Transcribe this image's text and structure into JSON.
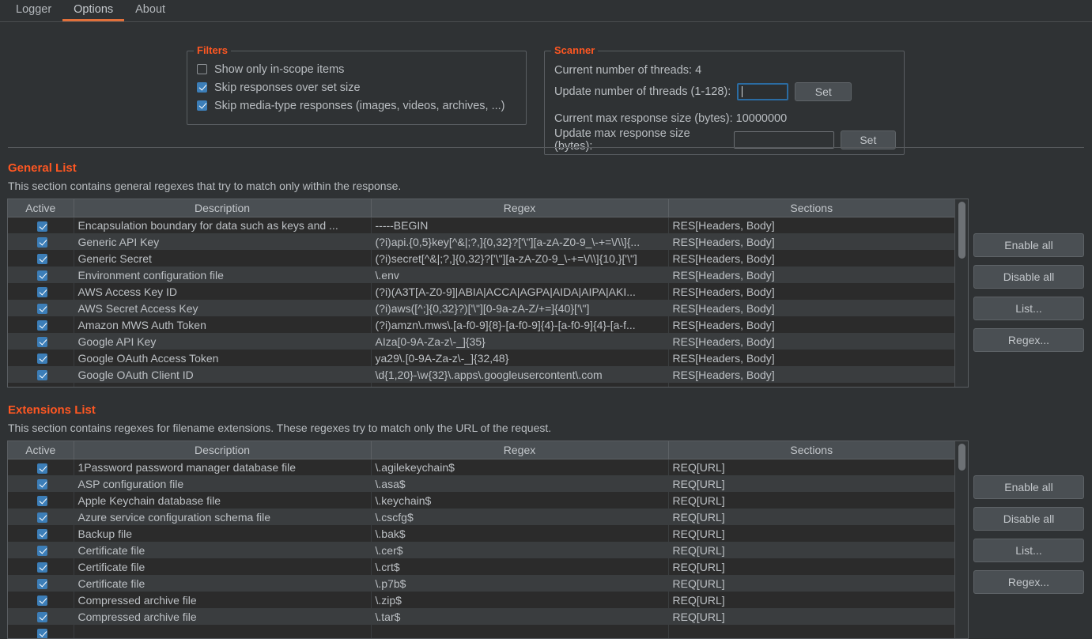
{
  "tabs": [
    {
      "label": "Logger",
      "active": false
    },
    {
      "label": "Options",
      "active": true
    },
    {
      "label": "About",
      "active": false
    }
  ],
  "colors": {
    "accent": "#ff5722",
    "tab_active_underline": "#e2703a",
    "checkbox_checked": "#3c7eb8",
    "focus_border": "#2b6ca3",
    "background": "#2f3234",
    "row_odd": "#2b2b2b",
    "row_even": "#3a3d3f",
    "header_bg": "#4a4f53"
  },
  "filters": {
    "legend": "Filters",
    "options": [
      {
        "label": "Show only in-scope items",
        "checked": false
      },
      {
        "label": "Skip responses over set size",
        "checked": true
      },
      {
        "label": "Skip media-type responses (images, videos, archives, ...)",
        "checked": true
      }
    ]
  },
  "scanner": {
    "legend": "Scanner",
    "current_threads_label": "Current number of threads: 4",
    "update_threads_label": "Update number of threads (1-128):",
    "threads_input_value": "",
    "threads_set_label": "Set",
    "current_maxsize_label": "Current max response size (bytes): 10000000",
    "update_maxsize_label": "Update max response size (bytes):",
    "maxsize_input_value": "",
    "maxsize_set_label": "Set"
  },
  "general_list": {
    "title": "General List",
    "description": "This section contains general regexes that try to match only within the response.",
    "columns": [
      "Active",
      "Description",
      "Regex",
      "Sections"
    ],
    "buttons": [
      "Enable all",
      "Disable all",
      "List...",
      "Regex..."
    ],
    "rows": [
      {
        "active": true,
        "description": "Encapsulation boundary for data such as keys and ...",
        "regex": "-----BEGIN",
        "sections": "RES[Headers, Body]"
      },
      {
        "active": true,
        "description": "Generic API Key",
        "regex": "(?i)api.{0,5}key[^&|;?,]{0,32}?['\\\"][a-zA-Z0-9_\\-+=\\/\\\\]{...",
        "sections": "RES[Headers, Body]"
      },
      {
        "active": true,
        "description": "Generic Secret",
        "regex": "(?i)secret[^&|;?,]{0,32}?['\\\"][a-zA-Z0-9_\\-+=\\/\\\\]{10,}['\\\"]",
        "sections": "RES[Headers, Body]"
      },
      {
        "active": true,
        "description": "Environment configuration file",
        "regex": "\\.env",
        "sections": "RES[Headers, Body]"
      },
      {
        "active": true,
        "description": "AWS Access Key ID",
        "regex": "(?i)(A3T[A-Z0-9]|ABIA|ACCA|AGPA|AIDA|AIPA|AKI...",
        "sections": "RES[Headers, Body]"
      },
      {
        "active": true,
        "description": "AWS Secret Access Key",
        "regex": "(?i)aws([^;]{0,32}?)['\\\"][0-9a-zA-Z/+=]{40}['\\\"]",
        "sections": "RES[Headers, Body]"
      },
      {
        "active": true,
        "description": "Amazon MWS Auth Token",
        "regex": "(?i)amzn\\.mws\\.[a-f0-9]{8}-[a-f0-9]{4}-[a-f0-9]{4}-[a-f...",
        "sections": "RES[Headers, Body]"
      },
      {
        "active": true,
        "description": "Google API Key",
        "regex": "AIza[0-9A-Za-z\\-_]{35}",
        "sections": "RES[Headers, Body]"
      },
      {
        "active": true,
        "description": "Google OAuth Access Token",
        "regex": "ya29\\.[0-9A-Za-z\\-_]{32,48}",
        "sections": "RES[Headers, Body]"
      },
      {
        "active": true,
        "description": "Google OAuth Client ID",
        "regex": "\\d{1,20}-\\w{32}\\.apps\\.googleusercontent\\.com",
        "sections": "RES[Headers, Body]"
      },
      {
        "active": true,
        "description": "",
        "regex": "",
        "sections": ""
      }
    ]
  },
  "extensions_list": {
    "title": "Extensions List",
    "description": "This section contains regexes for filename extensions. These regexes try to match only the URL of the request.",
    "columns": [
      "Active",
      "Description",
      "Regex",
      "Sections"
    ],
    "buttons": [
      "Enable all",
      "Disable all",
      "List...",
      "Regex..."
    ],
    "rows": [
      {
        "active": true,
        "description": "1Password password manager database file",
        "regex": "\\.agilekeychain$",
        "sections": "REQ[URL]"
      },
      {
        "active": true,
        "description": "ASP configuration file",
        "regex": "\\.asa$",
        "sections": "REQ[URL]"
      },
      {
        "active": true,
        "description": "Apple Keychain database file",
        "regex": "\\.keychain$",
        "sections": "REQ[URL]"
      },
      {
        "active": true,
        "description": "Azure service configuration schema file",
        "regex": "\\.cscfg$",
        "sections": "REQ[URL]"
      },
      {
        "active": true,
        "description": "Backup file",
        "regex": "\\.bak$",
        "sections": "REQ[URL]"
      },
      {
        "active": true,
        "description": "Certificate file",
        "regex": "\\.cer$",
        "sections": "REQ[URL]"
      },
      {
        "active": true,
        "description": "Certificate file",
        "regex": "\\.crt$",
        "sections": "REQ[URL]"
      },
      {
        "active": true,
        "description": "Certificate file",
        "regex": "\\.p7b$",
        "sections": "REQ[URL]"
      },
      {
        "active": true,
        "description": "Compressed archive file",
        "regex": "\\.zip$",
        "sections": "REQ[URL]"
      },
      {
        "active": true,
        "description": "Compressed archive file",
        "regex": "\\.tar$",
        "sections": "REQ[URL]"
      },
      {
        "active": true,
        "description": "",
        "regex": "",
        "sections": ""
      }
    ]
  }
}
